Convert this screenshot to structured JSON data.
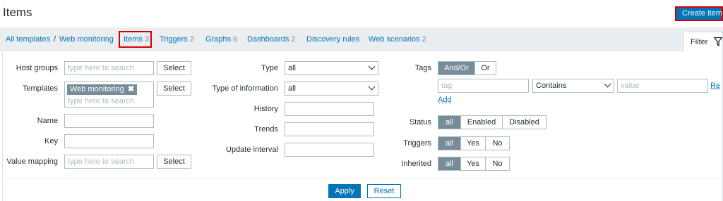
{
  "page": {
    "title": "Items",
    "create_button": "Create item"
  },
  "nav": {
    "breadcrumb": [
      {
        "label": "All templates"
      },
      {
        "label": "Web monitoring"
      }
    ],
    "separator": "/",
    "tabs": [
      {
        "label": "Items",
        "count": "3"
      },
      {
        "label": "Triggers",
        "count": "2"
      },
      {
        "label": "Graphs",
        "count": "6"
      },
      {
        "label": "Dashboards",
        "count": "2"
      },
      {
        "label": "Discovery rules",
        "count": ""
      },
      {
        "label": "Web scenarios",
        "count": "2"
      }
    ]
  },
  "filter_tab": {
    "label": "Filter",
    "icon": "funnel-icon"
  },
  "filter": {
    "host_groups": {
      "label": "Host groups",
      "placeholder": "type here to search",
      "select_label": "Select"
    },
    "templates": {
      "label": "Templates",
      "chip": "Web monitoring",
      "chip_remove": "✖",
      "placeholder": "type here to search",
      "select_label": "Select"
    },
    "name": {
      "label": "Name",
      "value": ""
    },
    "key": {
      "label": "Key",
      "value": ""
    },
    "value_mapping": {
      "label": "Value mapping",
      "placeholder": "type here to search",
      "select_label": "Select"
    },
    "type": {
      "label": "Type",
      "value": "all"
    },
    "type_of_information": {
      "label": "Type of information",
      "value": "all"
    },
    "history": {
      "label": "History",
      "value": ""
    },
    "trends": {
      "label": "Trends",
      "value": ""
    },
    "update_interval": {
      "label": "Update interval",
      "value": ""
    },
    "tags": {
      "label": "Tags",
      "options": [
        "And/Or",
        "Or"
      ],
      "selected": "And/Or",
      "tag_placeholder": "tag",
      "operator": "Contains",
      "value_placeholder": "value",
      "add_label": "Add",
      "remove_label": "Re"
    },
    "status": {
      "label": "Status",
      "options": [
        "all",
        "Enabled",
        "Disabled"
      ],
      "selected": "all"
    },
    "triggers": {
      "label": "Triggers",
      "options": [
        "all",
        "Yes",
        "No"
      ],
      "selected": "all"
    },
    "inherited": {
      "label": "Inherited",
      "options": [
        "all",
        "Yes",
        "No"
      ],
      "selected": "all"
    },
    "apply_label": "Apply",
    "reset_label": "Reset"
  }
}
